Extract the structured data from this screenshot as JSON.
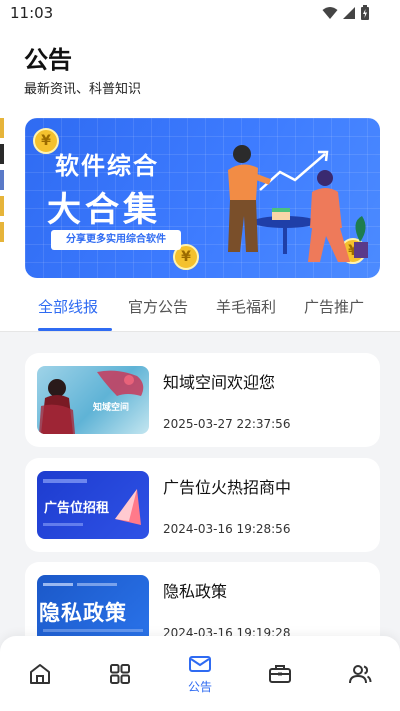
{
  "status_bar": {
    "time": "11:03"
  },
  "header": {
    "title": "公告",
    "subtitle": "最新资讯、科普知识"
  },
  "banner": {
    "line1": "软件综合",
    "line2": "大合集",
    "tagline": "分享更多实用综合软件",
    "coin_symbol": "¥"
  },
  "tabs": [
    {
      "label": "全部线报",
      "active": true
    },
    {
      "label": "官方公告",
      "active": false
    },
    {
      "label": "羊毛福利",
      "active": false
    },
    {
      "label": "广告推广",
      "active": false
    }
  ],
  "cards": [
    {
      "title": "知域空间欢迎您",
      "date": "2025-03-27 22:37:56",
      "thumb_text": "知域空间"
    },
    {
      "title": "广告位火热招商中",
      "date": "2024-03-16 19:28:56",
      "thumb_text": "广告位招租"
    },
    {
      "title": "隐私政策",
      "date": "2024-03-16 19:19:28",
      "thumb_text": "隐私政策"
    }
  ],
  "bottom_nav": {
    "items": [
      {
        "icon": "home-icon",
        "label": ""
      },
      {
        "icon": "apps-grid-icon",
        "label": ""
      },
      {
        "icon": "mail-icon",
        "label": "公告",
        "active": true
      },
      {
        "icon": "briefcase-icon",
        "label": ""
      },
      {
        "icon": "users-icon",
        "label": ""
      }
    ]
  },
  "colors": {
    "accent": "#2f6bf2",
    "background": "#f3f4f6"
  }
}
